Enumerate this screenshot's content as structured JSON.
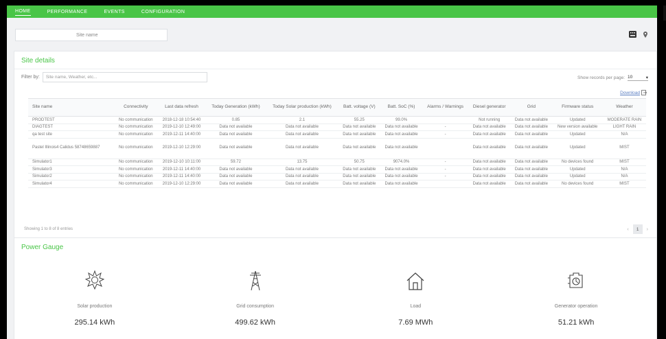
{
  "nav": {
    "items": [
      {
        "label": "HOME",
        "active": true
      },
      {
        "label": "PERFORMANCE",
        "active": false
      },
      {
        "label": "EVENTS",
        "active": false
      },
      {
        "label": "CONFIGURATION",
        "active": false
      }
    ],
    "edge_label": "<"
  },
  "search": {
    "placeholder": "Site name"
  },
  "site_panel": {
    "title": "Site details",
    "filter_label": "Filter by:",
    "filter_placeholder": "Site name, Weather, etc...",
    "show_records_label": "Show records per page:",
    "show_records_value": "10",
    "download_label": "Download",
    "columns": [
      "Site name",
      "Connectivity",
      "Last data refresh",
      "Today Generation (kWh)",
      "Today Solar production (kWh)",
      "Batt. voltage (V)",
      "Batt. SoC (%)",
      "Alarms / Warnings",
      "Diesel generator",
      "Grid",
      "Firmware status",
      "Weather"
    ],
    "rows": [
      [
        "PRODTEST",
        "No communication",
        "2018-12-18 10:54:40",
        "0.85",
        "2.1",
        "55.25",
        "99.0%",
        "",
        "Not running",
        "Data not available",
        "Updated",
        "MODERATE RAIN"
      ],
      [
        "DIAGTEST",
        "No communication",
        "2019-12-10 12:49:00",
        "Data not available",
        "Data not available",
        "Data not available",
        "Data not available",
        "-",
        "Data not available",
        "Data not available",
        "New version available",
        "LIGHT RAIN"
      ],
      [
        "qa test site",
        "No communication",
        "2019-12-11 14:40:00",
        "Data not available",
        "Data not available",
        "Data not available",
        "Data not available",
        "-",
        "Data not available",
        "Data not available",
        "Updated",
        "N/A"
      ],
      [
        "Pastel Illinois4 Calidus 58748659887",
        "No communication",
        "2019-12-10 12:29:00",
        "Data not available",
        "Data not available",
        "Data not available",
        "Data not available",
        "",
        "Data not available",
        "Data not available",
        "Updated",
        "MIST"
      ],
      [
        "Simulator1",
        "No communication",
        "2019-12-10 10:11:00",
        "59.72",
        "13.75",
        "50.75",
        "9074.0%",
        "-",
        "Data not available",
        "Data not available",
        "No devices found",
        "MIST"
      ],
      [
        "Simulator3",
        "No communication",
        "2019-12-11 14:40:00",
        "Data not available",
        "Data not available",
        "Data not available",
        "Data not available",
        "-",
        "Data not available",
        "Data not available",
        "Updated",
        "N/A"
      ],
      [
        "Simulator2",
        "No communication",
        "2019-12-11 14:40:00",
        "Data not available",
        "Data not available",
        "Data not available",
        "Data not available",
        "-",
        "Data not available",
        "Data not available",
        "Updated",
        "N/A"
      ],
      [
        "Simulator4",
        "No communication",
        "2019-12-10 12:29:00",
        "Data not available",
        "Data not available",
        "Data not available",
        "Data not available",
        "",
        "Data not available",
        "Data not available",
        "No devices found",
        "MIST"
      ]
    ],
    "footer": "Showing 1 to 8 of 8 entries",
    "page": "1"
  },
  "power_panel": {
    "title": "Power Gauge",
    "gauges": [
      {
        "icon": "sun-icon",
        "label": "Solar production",
        "value": "295.14 kWh"
      },
      {
        "icon": "pylon-icon",
        "label": "Grid consumption",
        "value": "499.62 kWh"
      },
      {
        "icon": "house-icon",
        "label": "Load",
        "value": "7.69 MWh"
      },
      {
        "icon": "generator-icon",
        "label": "Generator operation",
        "value": "51.21 kWh"
      }
    ]
  }
}
